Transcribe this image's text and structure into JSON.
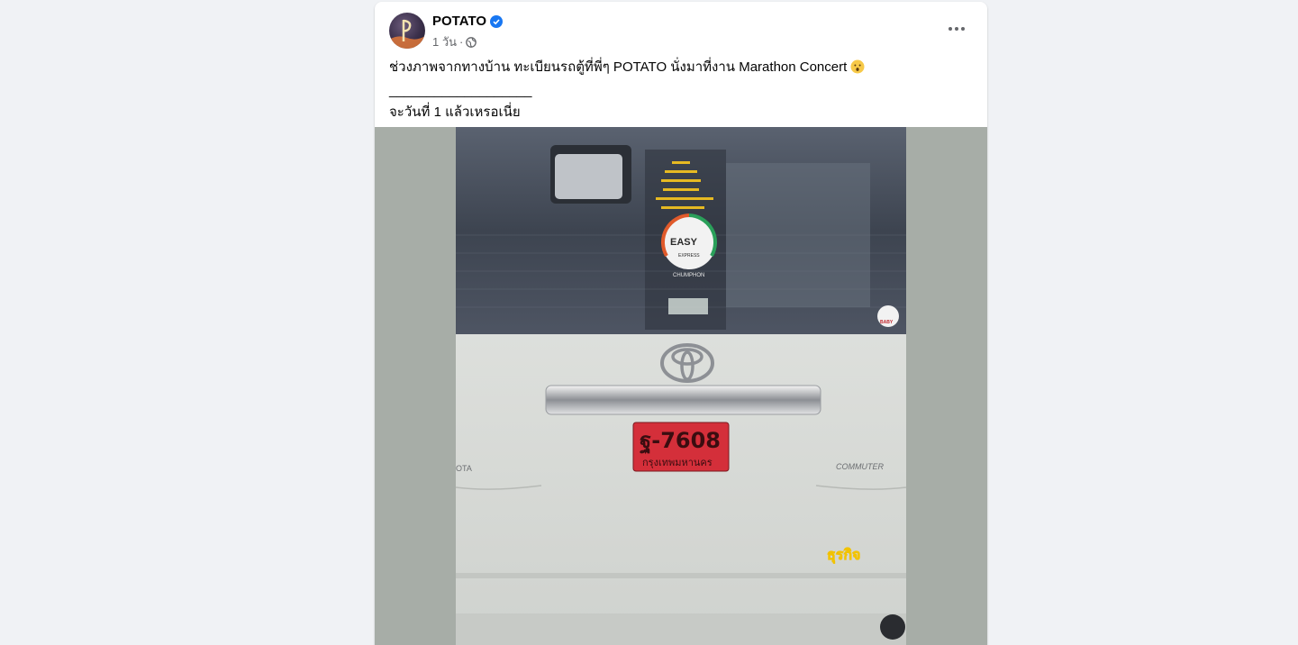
{
  "post": {
    "author": "POTATO",
    "time": "1 วัน",
    "separator": "·",
    "text_line1": "ช่วงภาพจากทางบ้าน ทะเบียนรถตู้ที่พี่ๆ POTATO นั่งมาที่งาน Marathon Concert",
    "divider": "___________________",
    "text_line3": "จะวันที่ 1 แล้วเหรอเนี่ย"
  },
  "photo": {
    "plate_number": "ฐ-7608",
    "plate_province": "กรุงเทพมหานคร",
    "sticker_brand": "EASY",
    "sticker_sub": "EXPRESS",
    "sticker_city": "CHUMPHON",
    "model_badge": "COMMUTER",
    "toyota_text": "OTA",
    "watermark": "ธุรกิจ",
    "baby_sticker": "BABY"
  },
  "colors": {
    "verified": "#1877f2",
    "plate_bg": "#d42f3a",
    "media_bg": "#a7ada7"
  }
}
